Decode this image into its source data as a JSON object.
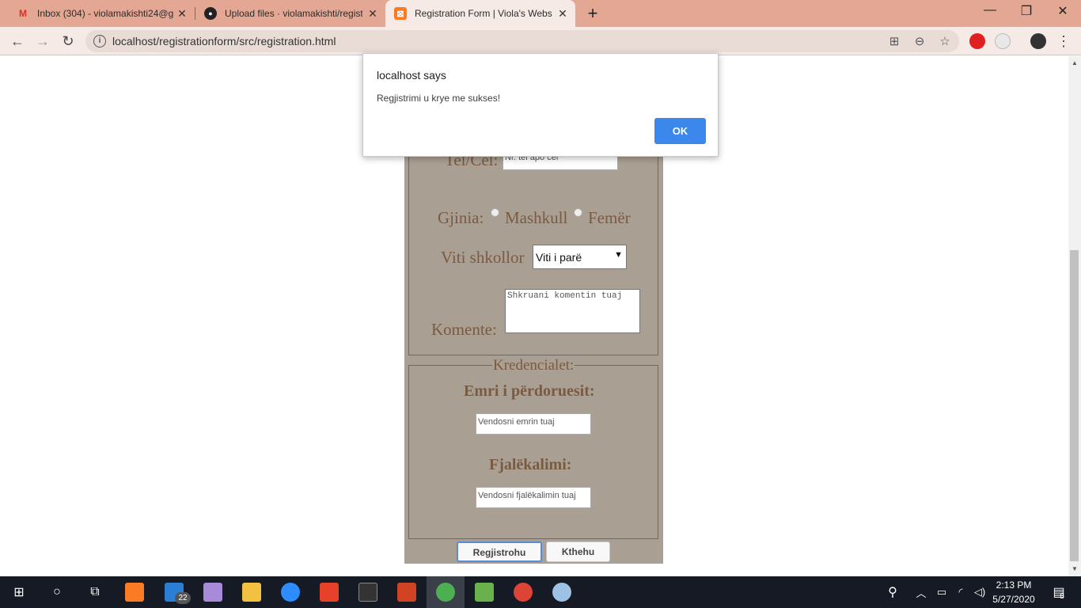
{
  "browser": {
    "tabs": [
      {
        "title": "Inbox (304) - violamakishti24@g",
        "icon": "gmail-icon",
        "close": "✕"
      },
      {
        "title": "Upload files · violamakishti/regist",
        "icon": "github-icon",
        "close": "✕"
      },
      {
        "title": "Registration Form | Viola's Websi",
        "icon": "xampp-icon",
        "close": "✕"
      }
    ],
    "new_tab": "+",
    "window_controls": {
      "minimize": "—",
      "maximize": "❐",
      "close": "✕"
    },
    "url": "localhost/registrationform/src/registration.html"
  },
  "form": {
    "phone_label": "Tel/Cel:",
    "phone_placeholder": "Nr. tel apo cel",
    "gender_label": "Gjinia:",
    "gender_male": "Mashkull",
    "gender_female": "Femër",
    "year_label": "Viti shkollor",
    "year_selected": "Viti i parë",
    "comments_label": "Komente:",
    "comments_placeholder": "Shkruani komentin tuaj",
    "credentials_legend": "Kredencialet:",
    "username_label": "Emri i përdoruesit:",
    "username_placeholder": "Vendosni emrin tuaj",
    "password_label": "Fjalëkalimi:",
    "password_placeholder": "Vendosni fjalëkalimin tuaj",
    "register_button": "Regjistrohu",
    "back_button": "Kthehu"
  },
  "dialog": {
    "title": "localhost says",
    "message": "Regjistrimi u krye me sukses!",
    "ok_label": "OK"
  },
  "taskbar": {
    "mail_badge": "22",
    "time": "2:13 PM",
    "date": "5/27/2020",
    "notification_count": "8"
  },
  "colors": {
    "tab_strip": "#e3a794",
    "form_bg": "#aa9f93",
    "label_text": "#7a5a41",
    "dialog_button": "#1a73e8"
  }
}
